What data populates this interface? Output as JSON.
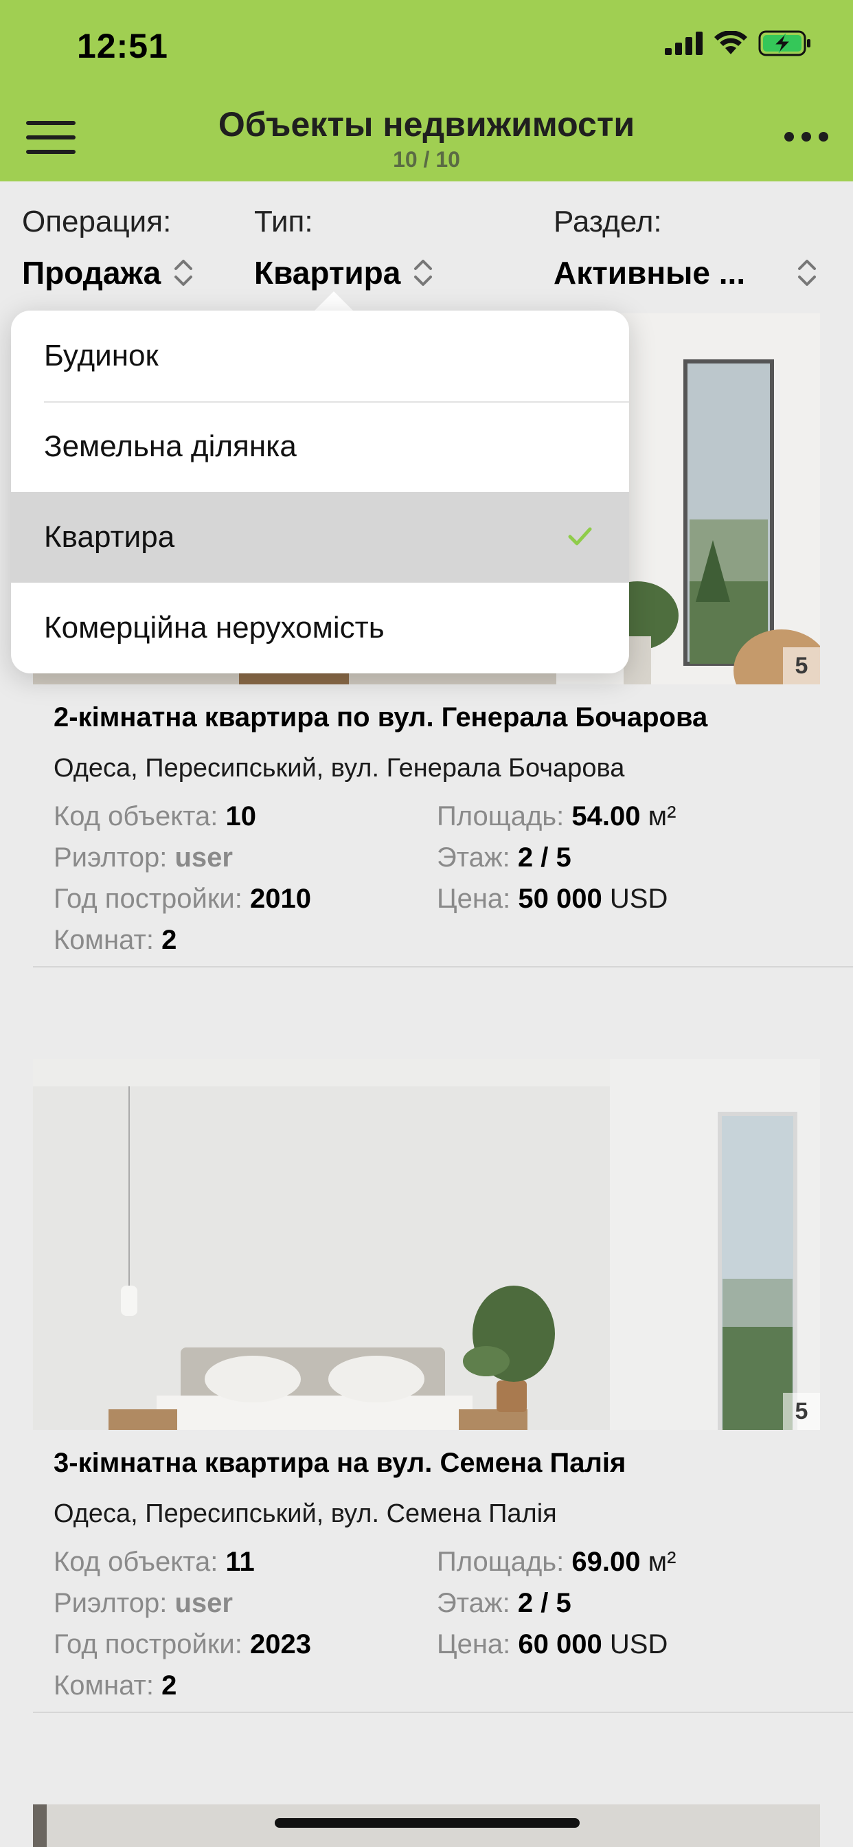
{
  "status_bar": {
    "time": "12:51"
  },
  "navbar": {
    "title": "Объекты недвижимости",
    "count": "10 / 10"
  },
  "filters": {
    "operation": {
      "label": "Операция:",
      "value": "Продажа"
    },
    "type": {
      "label": "Тип:",
      "value": "Квартира"
    },
    "section": {
      "label": "Раздел:",
      "value": "Активные ..."
    }
  },
  "dropdown": {
    "items": [
      {
        "label": "Будинок",
        "selected": false
      },
      {
        "label": "Земельна ділянка",
        "selected": false
      },
      {
        "label": "Квартира",
        "selected": true
      },
      {
        "label": "Комерційна нерухомість",
        "selected": false
      }
    ]
  },
  "labels": {
    "code": "Код объекта:",
    "realtor": "Риэлтор:",
    "year": "Год постройки:",
    "rooms": "Комнат:",
    "area": "Площадь:",
    "floor": "Этаж:",
    "price": "Цена:",
    "area_unit": "м²",
    "currency": "USD"
  },
  "listings": [
    {
      "photo_count": "5",
      "title": "2-кімнатна квартира по вул. Генерала Бочарова",
      "address": "Одеса, Пересипський, вул. Генерала Бочарова",
      "code": "10",
      "realtor": "user",
      "year": "2010",
      "rooms": "2",
      "area": "54.00",
      "floor": "2 / 5",
      "price": "50 000"
    },
    {
      "photo_count": "5",
      "title": "3-кімнатна квартира на вул. Семена Палія",
      "address": "Одеса, Пересипський, вул. Семена Палія",
      "code": "11",
      "realtor": "user",
      "year": "2023",
      "rooms": "2",
      "area": "69.00",
      "floor": "2 / 5",
      "price": "60 000"
    }
  ],
  "colors": {
    "accent": "#a0cf52",
    "check": "#8fcc4a",
    "background": "#ebebeb"
  }
}
